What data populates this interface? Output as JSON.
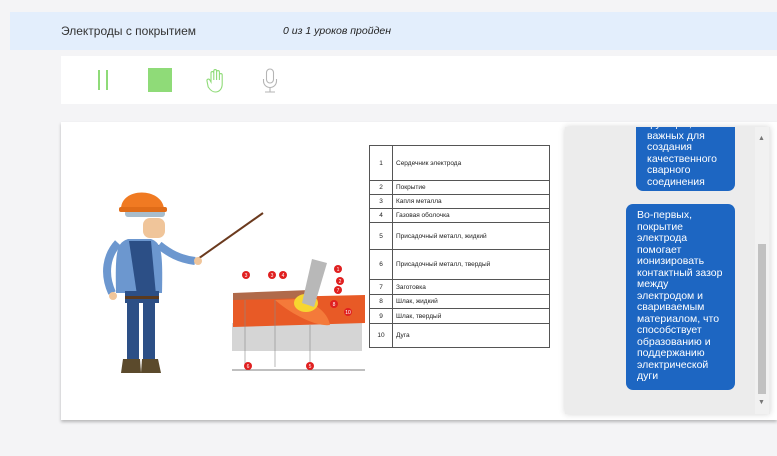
{
  "header": {
    "course_title": "Электроды с покрытием",
    "progress": "0 из 1 уроков пройден"
  },
  "controls": {
    "pause": "pause-icon",
    "stop": "stop-icon",
    "hand": "hand-icon",
    "mic": "microphone-icon",
    "accent_color": "#8fdb78"
  },
  "legend_table": {
    "rows": [
      {
        "num": "1",
        "label": "Сердечник электрода"
      },
      {
        "num": "2",
        "label": "Покрытие"
      },
      {
        "num": "3",
        "label": "Капля металла"
      },
      {
        "num": "4",
        "label": "Газовая оболочка"
      },
      {
        "num": "5",
        "label": "Присадочный металл, жидкий"
      },
      {
        "num": "6",
        "label": "Присадочный металл, твердый"
      },
      {
        "num": "7",
        "label": "Заготовка"
      },
      {
        "num": "8",
        "label": "Шлак, жидкий"
      },
      {
        "num": "9",
        "label": "Шлак, твердый"
      },
      {
        "num": "10",
        "label": "Дуга"
      }
    ]
  },
  "diagram_markers": [
    "3",
    "3",
    "4",
    "1",
    "2",
    "7",
    "10",
    "8",
    "6",
    "5"
  ],
  "chat": {
    "bubble1": "функции, важных для создания качественного сварного соединения",
    "bubble2": "Во-первых, покрытие электрода помогает ионизировать контактный зазор между электродом и свариваемым материалом, что способствует образованию и поддержанию электрической дуги",
    "bubble_color": "#1d66c2"
  }
}
